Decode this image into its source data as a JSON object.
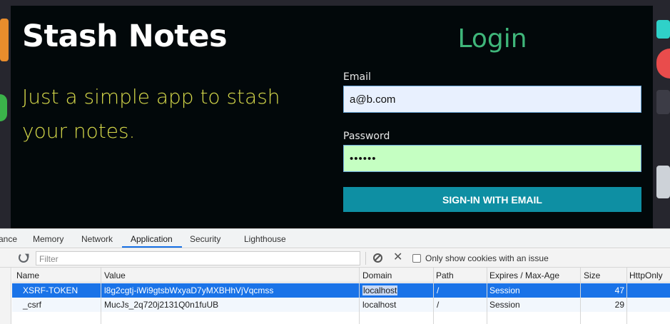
{
  "app": {
    "title": "Stash Notes",
    "tagline": "Just a simple app to stash your notes.",
    "login": {
      "heading": "Login",
      "email_label": "Email",
      "email_value": "a@b.com",
      "password_label": "Password",
      "password_value": "••••••",
      "signin_label": "SIGN-IN WITH EMAIL"
    }
  },
  "devtools": {
    "tabs": [
      "ance",
      "Memory",
      "Network",
      "Application",
      "Security",
      "Lighthouse"
    ],
    "active_tab": "Application",
    "filter_placeholder": "Filter",
    "only_issue_label": "Only show cookies with an issue",
    "columns": [
      "Name",
      "Value",
      "Domain",
      "Path",
      "Expires / Max-Age",
      "Size",
      "HttpOnly"
    ],
    "rows": [
      {
        "name": "XSRF-TOKEN",
        "value": "l8g2cgtj-iWi9gtsbWxyaD7yMXBHhVjVqcmss",
        "domain": "localhost",
        "path": "/",
        "expires": "Session",
        "size": "47"
      },
      {
        "name": "_csrf",
        "value": "MucJs_2q720j2131Q0n1fuUB",
        "domain": "localhost",
        "path": "/",
        "expires": "Session",
        "size": "29"
      }
    ]
  },
  "colors": {
    "accent": "#1a73e8",
    "login_green": "#3fb67a",
    "tagline_yellow": "#d6d94a",
    "signin_teal": "#0e8fa3"
  }
}
